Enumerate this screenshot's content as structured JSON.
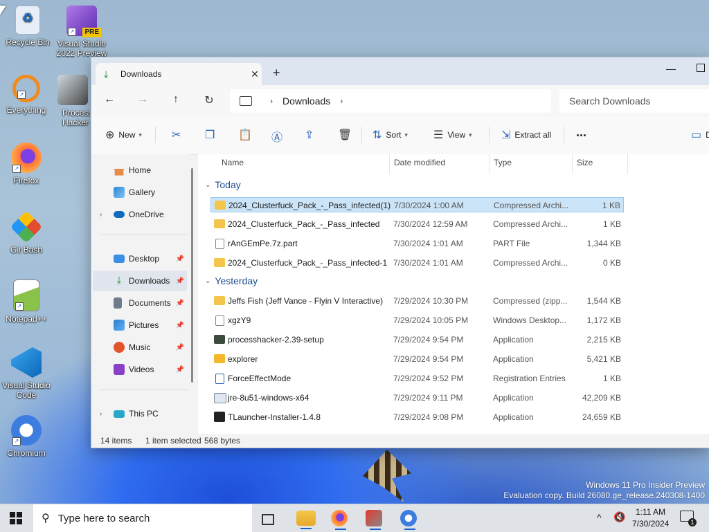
{
  "desktop": {
    "icons": [
      {
        "label": "Recycle Bin",
        "icon": "recycle-bin-icon",
        "color": "#dfe9f5"
      },
      {
        "label": "Visual Studio 2022 Preview",
        "icon": "visual-studio-preview-icon",
        "badge": "PRE",
        "color": "#7a3fc7"
      },
      {
        "label": "Everything",
        "icon": "everything-search-icon",
        "color": "#f28b1e"
      },
      {
        "label": "Process Hacker",
        "icon": "process-hacker-icon",
        "color": "#4a4a4a"
      },
      {
        "label": "Firefox",
        "icon": "firefox-icon",
        "color": "#ff7139"
      },
      {
        "label": "Git Bash",
        "icon": "git-bash-icon",
        "color": "#e24c2f"
      },
      {
        "label": "Notepad++",
        "icon": "notepadpp-icon",
        "color": "#8bc34a"
      },
      {
        "label": "Visual Studio Code",
        "icon": "vscode-icon",
        "color": "#1f8ad2"
      },
      {
        "label": "Chromium",
        "icon": "chromium-icon",
        "color": "#3d7de0"
      }
    ],
    "watermark_line1": "Windows 11 Pro Insider Preview",
    "watermark_line2": "Evaluation copy. Build 26080.ge_release.240308-1400"
  },
  "window": {
    "tab_title": "Downloads",
    "address_crumb": "Downloads",
    "search_placeholder": "Search Downloads",
    "toolbar": {
      "new_label": "New",
      "sort_label": "Sort",
      "view_label": "View",
      "extract_label": "Extract all",
      "more_label": "...",
      "details_label": "D"
    },
    "sidebar": {
      "home": "Home",
      "gallery": "Gallery",
      "onedrive": "OneDrive",
      "desktop": "Desktop",
      "downloads": "Downloads",
      "documents": "Documents",
      "pictures": "Pictures",
      "music": "Music",
      "videos": "Videos",
      "thispc": "This PC"
    },
    "columns": {
      "name": "Name",
      "date": "Date modified",
      "type": "Type",
      "size": "Size"
    },
    "groups": {
      "today": "Today",
      "yesterday": "Yesterday"
    },
    "files": [
      {
        "name": "2024_Clusterfuck_Pack_-_Pass_infected(1)",
        "date": "7/30/2024 1:00 AM",
        "type": "Compressed Archi...",
        "size": "1 KB",
        "icon": "zip-folder-icon"
      },
      {
        "name": "2024_Clusterfuck_Pack_-_Pass_infected",
        "date": "7/30/2024 12:59 AM",
        "type": "Compressed Archi...",
        "size": "1 KB",
        "icon": "zip-folder-icon"
      },
      {
        "name": "rAnGEmPe.7z.part",
        "date": "7/30/2024 1:01 AM",
        "type": "PART File",
        "size": "1,344 KB",
        "icon": "file-icon"
      },
      {
        "name": "2024_Clusterfuck_Pack_-_Pass_infected-1",
        "date": "7/30/2024 1:01 AM",
        "type": "Compressed Archi...",
        "size": "0 KB",
        "icon": "zip-folder-icon"
      },
      {
        "name": "Jeffs Fish (Jeff Vance - Flyin V Interactive)",
        "date": "7/29/2024 10:30 PM",
        "type": "Compressed (zipp...",
        "size": "1,544 KB",
        "icon": "zip-folder-icon"
      },
      {
        "name": "xgzY9",
        "date": "7/29/2024 10:05 PM",
        "type": "Windows Desktop...",
        "size": "1,172 KB",
        "icon": "theme-file-icon"
      },
      {
        "name": "processhacker-2.39-setup",
        "date": "7/29/2024 9:54 PM",
        "type": "Application",
        "size": "2,215 KB",
        "icon": "installer-icon"
      },
      {
        "name": "explorer",
        "date": "7/29/2024 9:54 PM",
        "type": "Application",
        "size": "5,421 KB",
        "icon": "folder-app-icon"
      },
      {
        "name": "ForceEffectMode",
        "date": "7/29/2024 9:52 PM",
        "type": "Registration Entries",
        "size": "1 KB",
        "icon": "registry-icon"
      },
      {
        "name": "jre-8u51-windows-x64",
        "date": "7/29/2024 9:11 PM",
        "type": "Application",
        "size": "42,209 KB",
        "icon": "java-installer-icon"
      },
      {
        "name": "TLauncher-Installer-1.4.8",
        "date": "7/29/2024 9:08 PM",
        "type": "Application",
        "size": "24,659 KB",
        "icon": "tlauncher-icon"
      }
    ],
    "status": {
      "count": "14 items",
      "selected": "1 item selected",
      "bytes": "568 bytes"
    }
  },
  "taskbar": {
    "search_placeholder": "Type here to search",
    "time": "1:11 AM",
    "date": "7/30/2024",
    "notification_count": "1"
  }
}
